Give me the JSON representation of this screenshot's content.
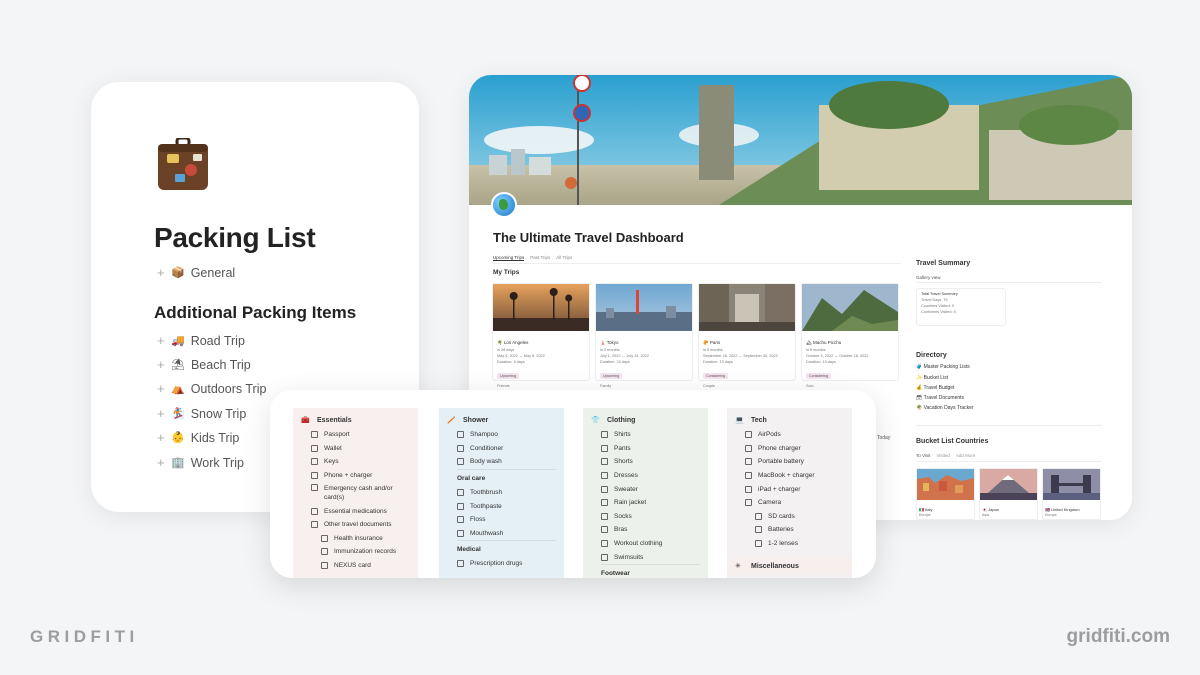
{
  "packing": {
    "title": "Packing List",
    "general": "General",
    "additional_heading": "Additional Packing Items",
    "items": [
      "Road Trip",
      "Beach Trip",
      "Outdoors Trip",
      "Snow Trip",
      "Kids Trip",
      "Work Trip"
    ],
    "icons": [
      "box-icon",
      "truck-icon",
      "beach-umbrella-icon",
      "tent-icon",
      "snowboarder-icon",
      "baby-icon",
      "office-building-icon"
    ]
  },
  "dashboard": {
    "title": "The Ultimate Travel Dashboard",
    "tabs": [
      "Upcoming Trips",
      "Past Trips",
      "All Trips"
    ],
    "my_trips": "My Trips",
    "trips": [
      {
        "name": "Los Angeles",
        "when": "in 28 days",
        "dates": "May 4, 2022 → May 8, 2022",
        "duration": "Duration: 4 days",
        "status": "Upcoming",
        "who": "Friends"
      },
      {
        "name": "Tokyo",
        "when": "in 2 months",
        "dates": "July 1, 2022 → July 24, 2022",
        "duration": "Duration: 24 days",
        "status": "Upcoming",
        "who": "Family"
      },
      {
        "name": "Paris",
        "when": "in 5 months",
        "dates": "September 18, 2022 → September 30, 2022",
        "duration": "Duration: 13 days",
        "status": "Considering",
        "who": "Couple"
      },
      {
        "name": "Machu Picchu",
        "when": "in 5 months",
        "dates": "October 4, 2022 → October 18, 2022",
        "duration": "Duration: 15 days",
        "status": "Considering",
        "who": "Solo"
      }
    ],
    "travel_summary": "Travel Summary",
    "gallery_view": "Gallery view",
    "summary_card": [
      "Total Travel Summary",
      "Travel Days: 79",
      "Countries Visited: 9",
      "Continents Visited: 5"
    ],
    "directory": "Directory",
    "directory_items": [
      "Master Packing Lists",
      "Bucket List",
      "Travel Budget",
      "Travel Documents",
      "Vacation Days Tracker"
    ],
    "bucket_list": "Bucket List Countries",
    "bucket_tabs": [
      "To Visit",
      "Visited",
      "Add More"
    ],
    "countries": [
      {
        "name": "Italy",
        "continent": "Europe"
      },
      {
        "name": "Japan",
        "continent": "Asia"
      },
      {
        "name": "United Kingdom",
        "continent": "Europe"
      }
    ],
    "today": "Today"
  },
  "checklist": {
    "essentials": {
      "title": "Essentials",
      "items": [
        "Passport",
        "Wallet",
        "Keys",
        "Phone + charger",
        "Emergency cash and/or card(s)",
        "Essential medications",
        "Other travel documents"
      ],
      "nested": [
        "Health insurance",
        "Immunization records",
        "NEXUS card"
      ]
    },
    "shower": {
      "title": "Shower",
      "items": [
        "Shampoo",
        "Conditioner",
        "Body wash"
      ],
      "oral_title": "Oral care",
      "oral": [
        "Toothbrush",
        "Toothpaste",
        "Floss",
        "Mouthwash"
      ],
      "medical_title": "Medical",
      "medical": [
        "Prescription drugs"
      ]
    },
    "clothing": {
      "title": "Clothing",
      "items": [
        "Shirts",
        "Pants",
        "Shorts",
        "Dresses",
        "Sweater",
        "Rain jacket",
        "Socks",
        "Bras",
        "Workout clothing",
        "Swimsuits"
      ],
      "footwear_title": "Footwear"
    },
    "tech": {
      "title": "Tech",
      "items": [
        "AirPods",
        "Phone charger",
        "Portable battery",
        "MacBook + charger",
        "iPad + charger",
        "Camera"
      ],
      "nested": [
        "SD cards",
        "Batteries",
        "1-2 lenses"
      ],
      "misc_title": "Miscellaneous"
    },
    "colors": {
      "essentials": "#f8f0ef",
      "shower": "#e4f0f6",
      "clothing": "#edf1ec",
      "tech": "#f3f1f1"
    }
  },
  "brand": {
    "left": "GRIDFITI",
    "right": "gridfiti.com"
  }
}
